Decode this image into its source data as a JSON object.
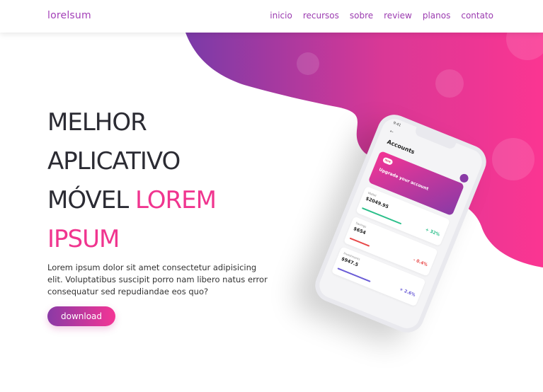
{
  "nav": {
    "logo": "lorelsum",
    "links": [
      "inicio",
      "recursos",
      "sobre",
      "review",
      "planos",
      "contato"
    ]
  },
  "hero": {
    "title_line1": "MELHOR",
    "title_line2": "APLICATIVO",
    "title_line3_plain": "MÓVEL ",
    "title_line3_accent": "LOREM",
    "title_line4_accent": "IPSUM",
    "description": "Lorem ipsum dolor sit amet consectetur adipisicing elit. Voluptatibus suscipit porro nam libero natus error consequatur sed repudiandae eos quo?",
    "download_label": "download"
  },
  "phone": {
    "time": "9:41",
    "back": "←",
    "title": "Accounts",
    "promo_pill": "New",
    "promo_text": "Upgrade your account",
    "accounts": [
      {
        "label": "Wallet",
        "amount": "$2049.95",
        "change": "+ 32%",
        "color": "#2bbf8a"
      },
      {
        "label": "Savings",
        "amount": "$654",
        "change": "- 0.4%",
        "color": "#e84a4a"
      },
      {
        "label": "Investments",
        "amount": "$947.5",
        "change": "+ 2.6%",
        "color": "#6a5cd6"
      }
    ]
  },
  "colors": {
    "accent_pink": "#f0358f",
    "accent_purple": "#8a3aa6",
    "nav_text": "#9b3bb0"
  }
}
